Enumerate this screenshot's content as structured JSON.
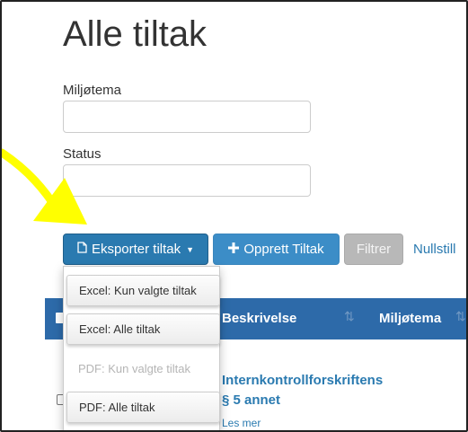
{
  "page": {
    "title": "Alle tiltak"
  },
  "filters": {
    "miljotema_label": "Miljøtema",
    "miljotema_value": "",
    "status_label": "Status",
    "status_value": ""
  },
  "toolbar": {
    "export_label": "Eksporter tiltak",
    "create_label": "Opprett Tiltak",
    "filter_label": "Filtrer",
    "reset_label": "Nullstill"
  },
  "export_menu": {
    "items": [
      {
        "label": "Excel: Kun valgte tiltak",
        "disabled": false
      },
      {
        "label": "Excel: Alle tiltak",
        "disabled": false
      },
      {
        "label": "PDF: Kun valgte tiltak",
        "disabled": true
      },
      {
        "label": "PDF: Alle tiltak",
        "disabled": false
      }
    ]
  },
  "table": {
    "columns": [
      "Beskrivelse",
      "Miljøtema"
    ],
    "rows": [
      {
        "title": "Internkontrollforskriftens § 5 annet",
        "more": "Les mer"
      }
    ]
  },
  "annotation": {
    "color": "#ffff00"
  }
}
